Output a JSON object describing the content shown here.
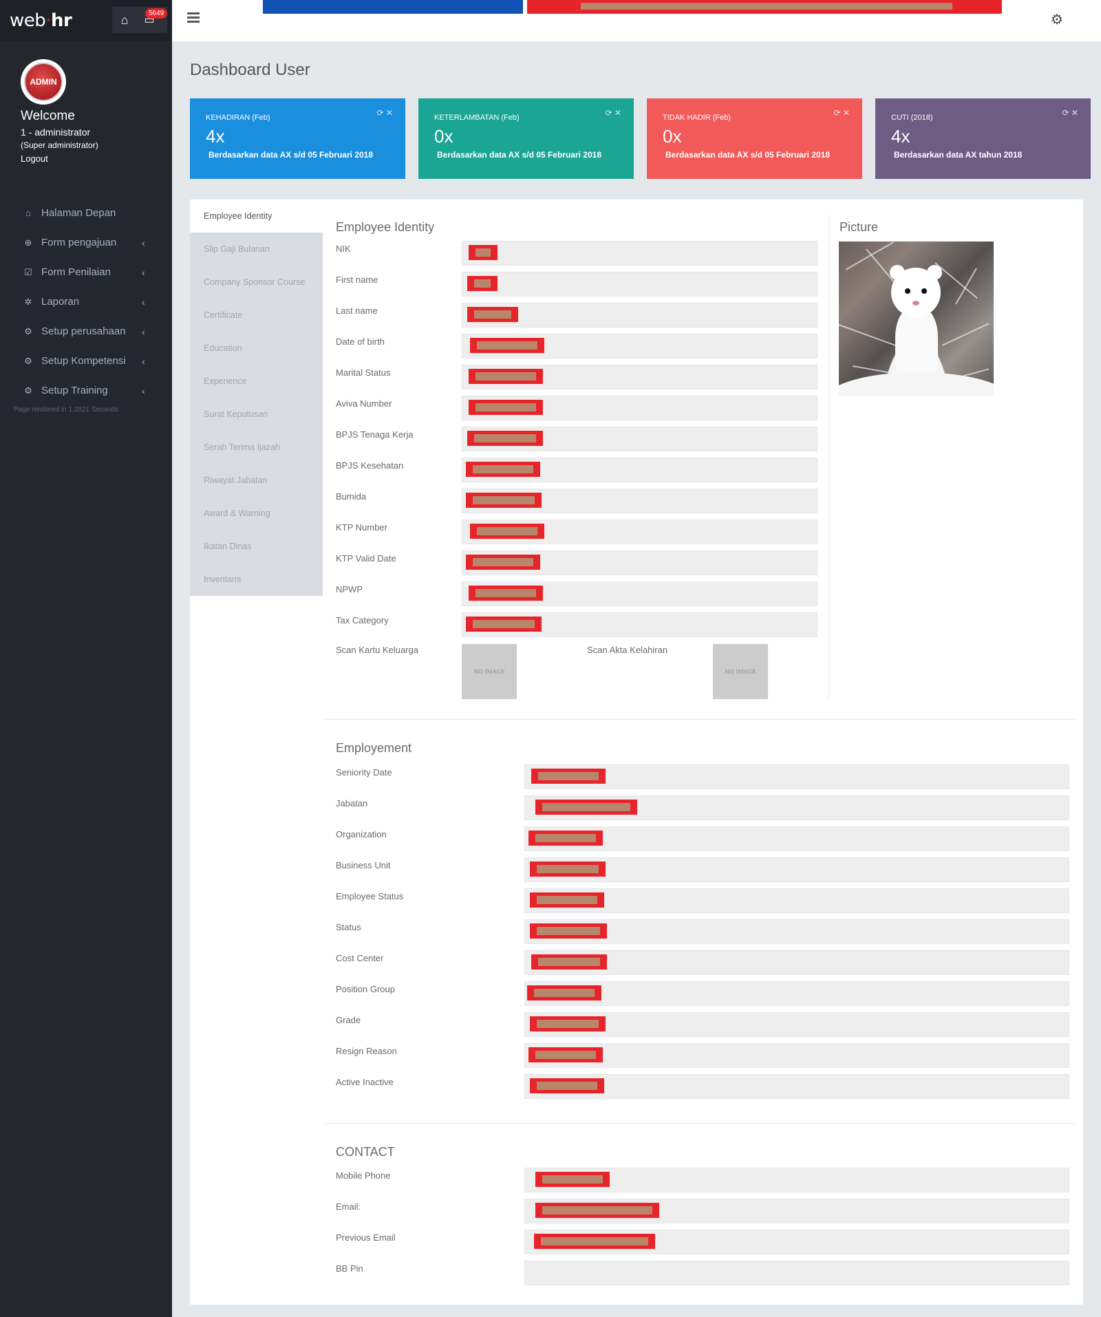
{
  "brand": {
    "logo_prefix": "web",
    "logo_dot": "·",
    "logo_suffix": "hr",
    "notification_count": "5649"
  },
  "profile": {
    "avatar_text": "ADMIN",
    "welcome": "Welcome",
    "user": "1 - administrator",
    "role": "(Super administrator)",
    "logout": "Logout"
  },
  "nav": [
    {
      "label": "Halaman Depan",
      "icon": "home-icon",
      "glyph": "⌂",
      "has_chevron": false
    },
    {
      "label": "Form pengajuan",
      "icon": "plus-circle-icon",
      "glyph": "⊕",
      "has_chevron": true
    },
    {
      "label": "Form Penilaian",
      "icon": "check-square-icon",
      "glyph": "☑",
      "has_chevron": true
    },
    {
      "label": "Laporan",
      "icon": "cog-icon",
      "glyph": "✲",
      "has_chevron": true
    },
    {
      "label": "Setup perusahaan",
      "icon": "cogs-icon",
      "glyph": "⚙",
      "has_chevron": true
    },
    {
      "label": "Setup Kompetensi",
      "icon": "cogs-icon",
      "glyph": "⚙",
      "has_chevron": true
    },
    {
      "label": "Setup Training",
      "icon": "cogs-icon",
      "glyph": "⚙",
      "has_chevron": true
    }
  ],
  "render_note": "Page rendered in 1.2821 Seconds",
  "page_title": "Dashboard User",
  "widgets": [
    {
      "title": "KEHADIRAN (Feb)",
      "value": "4x",
      "desc": "Berdasarkan data AX s/d 05 Februari 2018",
      "color": "#1a8fde"
    },
    {
      "title": "KETERLAMBATAN (Feb)",
      "value": "0x",
      "desc": "Berdasarkan data AX s/d 05 Februari 2018",
      "color": "#1ba595"
    },
    {
      "title": "TIDAK HADIR (Feb)",
      "value": "0x",
      "desc": "Berdasarkan data AX s/d 05 Februari 2018",
      "color": "#f25a5a"
    },
    {
      "title": "CUTI (2018)",
      "value": "4x",
      "desc": "Berdasarkan data AX tahun 2018",
      "color": "#6d5d85"
    }
  ],
  "widget_controls": "⟳ ✕",
  "tabs": [
    "Employee Identity",
    "Slip Gaji Bulanan",
    "Company Sponsor Course",
    "Certificate",
    "Education",
    "Experience",
    "Surat Keputusan",
    "Serah Terima Ijazah",
    "Riwayat Jabatan",
    "Award & Warning",
    "Ikatan Dinas",
    "Inventaris"
  ],
  "identity": {
    "title": "Employee Identity",
    "fields": [
      "NIK",
      "First name",
      "Last name",
      "Date of birth",
      "Marital Status",
      "Aviva Number",
      "BPJS Tenaga Kerja",
      "BPJS Kesehatan",
      "Bumida",
      "KTP Number",
      "KTP Valid Date",
      "NPWP",
      "Tax Category"
    ],
    "scan_kk_label": "Scan Kartu Keluarga",
    "scan_akta_label": "Scan Akta Kelahiran",
    "no_image": "NO IMAGE"
  },
  "picture_title": "Picture",
  "employment": {
    "title": "Employement",
    "fields": [
      "Seniority Date",
      "Jabatan",
      "Organization",
      "Business Unit",
      "Employee Status",
      "Status",
      "Cost Center",
      "Position Group",
      "Grade",
      "Resign Reason",
      "Active Inactive"
    ]
  },
  "contact": {
    "title": "CONTACT",
    "fields": [
      "Mobile Phone",
      "Email:",
      "Previous Email",
      "BB Pin"
    ]
  }
}
